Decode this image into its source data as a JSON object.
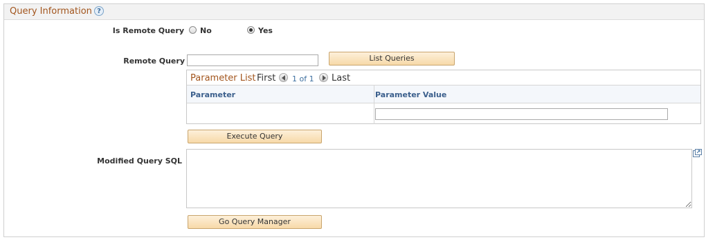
{
  "section": {
    "title": "Query Information",
    "help_glyph": "?"
  },
  "remote_query_toggle": {
    "label": "Is Remote Query",
    "options": [
      {
        "label": "No",
        "selected": false
      },
      {
        "label": "Yes",
        "selected": true
      }
    ]
  },
  "remote_query": {
    "label": "Remote Query",
    "value": "",
    "button_label": "List Queries"
  },
  "parameter_list": {
    "title": "Parameter List",
    "first_label": "First",
    "count_text": "1 of 1",
    "last_label": "Last",
    "columns": [
      "Parameter",
      "Parameter Value"
    ],
    "rows": [
      {
        "parameter": "",
        "value": ""
      }
    ]
  },
  "execute_button_label": "Execute Query",
  "modified_sql": {
    "label": "Modified Query SQL",
    "value": ""
  },
  "go_query_manager_label": "Go Query Manager",
  "colors": {
    "section_title": "#a2551d",
    "column_header": "#3b5f8c",
    "button_fill": "#f7d9a8",
    "link_blue": "#3d6f9f"
  },
  "icons": [
    "help-icon",
    "radio-icon",
    "nav-left-arrow-icon",
    "nav-right-arrow-icon",
    "expand-icon"
  ]
}
